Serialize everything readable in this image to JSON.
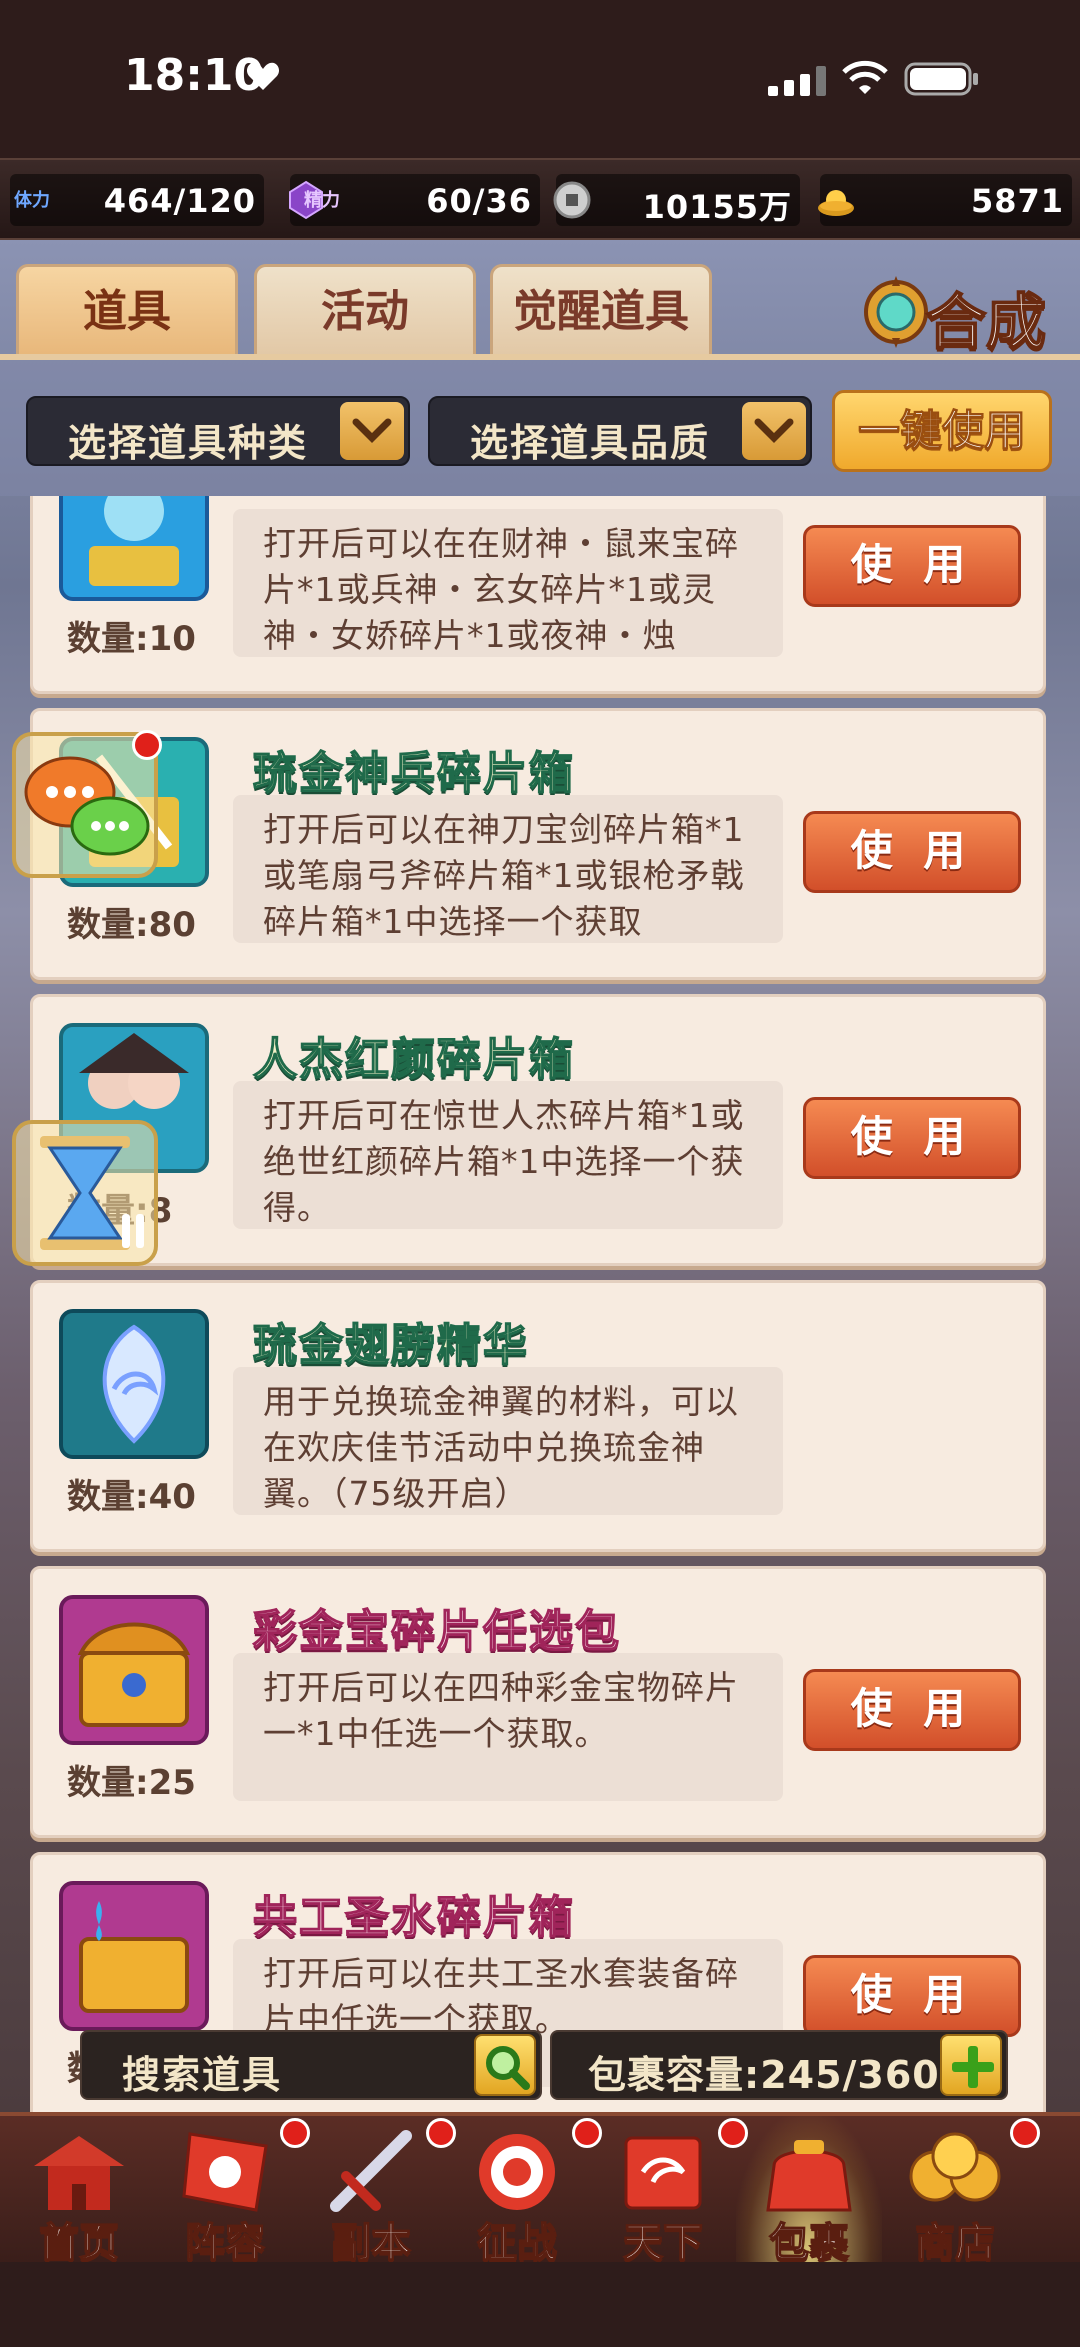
{
  "status": {
    "time": "18:10"
  },
  "resources": [
    {
      "label": "体力",
      "value": "464/120"
    },
    {
      "label": "精力",
      "value": "60/36"
    },
    {
      "label": "铜钱",
      "value": "10155万"
    },
    {
      "label": "元宝",
      "value": "5871"
    }
  ],
  "tabs": [
    {
      "label": "道具",
      "active": true
    },
    {
      "label": "活动",
      "active": false
    },
    {
      "label": "觉醒道具",
      "active": false
    }
  ],
  "synth_label": "合成",
  "filters": {
    "type_label": "选择道具种类",
    "quality_label": "选择道具品质",
    "one_key_label": "一键使用"
  },
  "items": [
    {
      "title": "",
      "desc": "打开后可以在在财神・鼠来宝碎片*1或兵神・玄女碎片*1或灵神・女娇碎片*1或夜神・烛",
      "qty": "数量:10",
      "use": "使 用"
    },
    {
      "title": "琉金神兵碎片箱",
      "desc": "打开后可以在神刀宝剑碎片箱*1或笔扇弓斧碎片箱*1或银枪矛戟碎片箱*1中选择一个获取",
      "qty": "数量:80",
      "use": "使 用"
    },
    {
      "title": "人杰红颜碎片箱",
      "desc": "打开后可在惊世人杰碎片箱*1或绝世红颜碎片箱*1中选择一个获得。",
      "qty": "数量:8",
      "use": "使 用"
    },
    {
      "title": "琉金翅膀精华",
      "desc": "用于兑换琉金神翼的材料，可以在欢庆佳节活动中兑换琉金神翼。（75级开启）",
      "qty": "数量:40",
      "use": ""
    },
    {
      "title": "彩金宝碎片任选包",
      "desc": "打开后可以在四种彩金宝物碎片一*1中任选一个获取。",
      "qty": "数量:25",
      "use": "使 用"
    },
    {
      "title": "共工圣水碎片箱",
      "desc": "打开后可以在共工圣水套装备碎片中任选一个获取。",
      "qty": "数量",
      "use": "使 用"
    }
  ],
  "search": {
    "placeholder": "搜索道具"
  },
  "capacity": {
    "text": "包裹容量:245/360"
  },
  "nav": [
    {
      "label": "首页"
    },
    {
      "label": "阵容"
    },
    {
      "label": "副本"
    },
    {
      "label": "征战"
    },
    {
      "label": "天下"
    },
    {
      "label": "包裹"
    },
    {
      "label": "商店"
    }
  ]
}
